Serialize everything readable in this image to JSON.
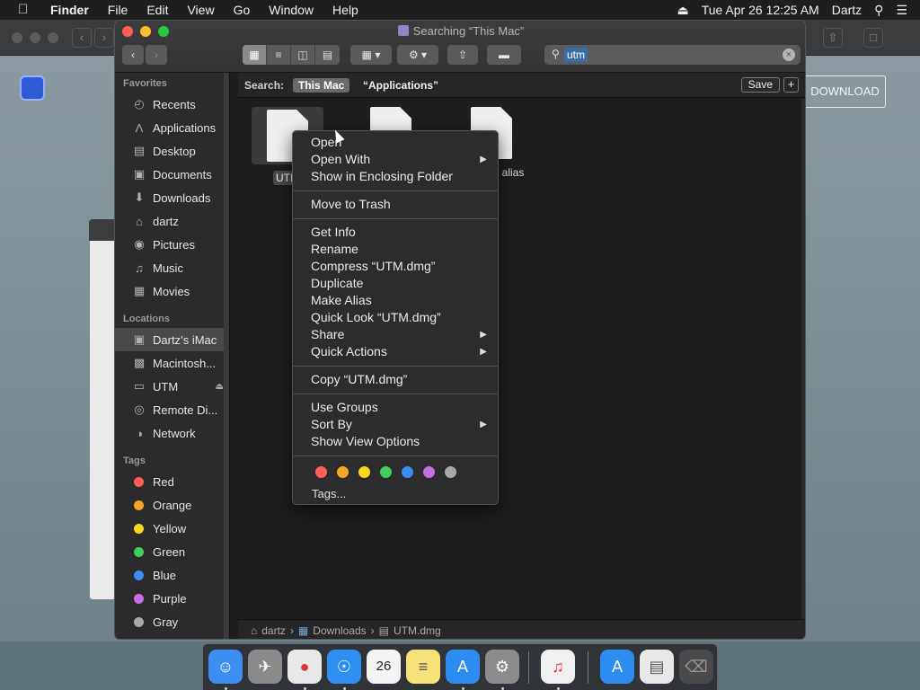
{
  "menubar": {
    "app_name": "Finder",
    "items": [
      "File",
      "Edit",
      "View",
      "Go",
      "Window",
      "Help"
    ],
    "datetime": "Tue Apr 26  12:25 AM",
    "user": "Dartz"
  },
  "background": {
    "download_label": "DOWNLOAD"
  },
  "window": {
    "title": "Searching “This Mac”",
    "search_value": "utm"
  },
  "sidebar": {
    "favorites_header": "Favorites",
    "favorites": [
      {
        "label": "Recents",
        "icon": "recents-icon"
      },
      {
        "label": "Applications",
        "icon": "applications-icon"
      },
      {
        "label": "Desktop",
        "icon": "desktop-icon"
      },
      {
        "label": "Documents",
        "icon": "documents-icon"
      },
      {
        "label": "Downloads",
        "icon": "downloads-icon"
      },
      {
        "label": "dartz",
        "icon": "home-icon"
      },
      {
        "label": "Pictures",
        "icon": "pictures-icon"
      },
      {
        "label": "Music",
        "icon": "music-icon"
      },
      {
        "label": "Movies",
        "icon": "movies-icon"
      }
    ],
    "locations_header": "Locations",
    "locations": [
      {
        "label": "Dartz’s iMac",
        "icon": "imac-icon"
      },
      {
        "label": "Macintosh...",
        "icon": "disk-icon"
      },
      {
        "label": "UTM",
        "icon": "volume-icon"
      },
      {
        "label": "Remote Di...",
        "icon": "remote-disc-icon"
      },
      {
        "label": "Network",
        "icon": "network-icon"
      }
    ],
    "tags_header": "Tags",
    "tags": [
      {
        "label": "Red",
        "color": "#ff5f57"
      },
      {
        "label": "Orange",
        "color": "#f5a623"
      },
      {
        "label": "Yellow",
        "color": "#f8d91c"
      },
      {
        "label": "Green",
        "color": "#3ed15a"
      },
      {
        "label": "Blue",
        "color": "#3b8cf5"
      },
      {
        "label": "Purple",
        "color": "#c86de6"
      },
      {
        "label": "Gray",
        "color": "#a8a8a8"
      }
    ]
  },
  "scope": {
    "label": "Search:",
    "active": "This Mac",
    "other": "“Applications”",
    "save_label": "Save",
    "add_label": "+"
  },
  "files": [
    {
      "name": "UTM",
      "selected": true
    },
    {
      "name": "",
      "selected": false
    },
    {
      "name": "g alias",
      "selected": false
    }
  ],
  "context_menu": {
    "groups": [
      [
        {
          "label": "Open"
        },
        {
          "label": "Open With",
          "submenu": true
        },
        {
          "label": "Show in Enclosing Folder"
        }
      ],
      [
        {
          "label": "Move to Trash"
        }
      ],
      [
        {
          "label": "Get Info"
        },
        {
          "label": "Rename"
        },
        {
          "label": "Compress “UTM.dmg”"
        },
        {
          "label": "Duplicate"
        },
        {
          "label": "Make Alias"
        },
        {
          "label": "Quick Look “UTM.dmg”"
        },
        {
          "label": "Share",
          "submenu": true
        },
        {
          "label": "Quick Actions",
          "submenu": true
        }
      ],
      [
        {
          "label": "Copy “UTM.dmg”"
        }
      ],
      [
        {
          "label": "Use Groups"
        },
        {
          "label": "Sort By",
          "submenu": true
        },
        {
          "label": "Show View Options"
        }
      ]
    ],
    "tag_colors": [
      "#ff5f57",
      "#f5a623",
      "#f8d91c",
      "#3ed15a",
      "#3b8cf5",
      "#c86de6",
      "#a8a8a8"
    ],
    "tags_label": "Tags..."
  },
  "path_bar": [
    {
      "label": "dartz",
      "icon": "home-icon"
    },
    {
      "label": "Downloads",
      "icon": "folder-icon"
    },
    {
      "label": "UTM.dmg",
      "icon": "file-icon"
    }
  ],
  "dock": {
    "items": [
      {
        "name": "finder-icon",
        "bg": "#3d8ef0",
        "glyph": "☺",
        "running": true
      },
      {
        "name": "launchpad-icon",
        "bg": "#8a8a8a",
        "glyph": "✈",
        "running": false
      },
      {
        "name": "chrome-icon",
        "bg": "#e8e8e8",
        "glyph": "●",
        "running": true
      },
      {
        "name": "safari-icon",
        "bg": "#2f8ff0",
        "glyph": "☉",
        "running": true
      },
      {
        "name": "calendar-icon",
        "bg": "#f4f4f4",
        "glyph": "26",
        "running": false
      },
      {
        "name": "notes-icon",
        "bg": "#f7e27a",
        "glyph": "≡",
        "running": false
      },
      {
        "name": "app-store-icon",
        "bg": "#2d8cf0",
        "glyph": "A",
        "running": true
      },
      {
        "name": "system-preferences-icon",
        "bg": "#8b8b8b",
        "glyph": "⚙",
        "running": true
      },
      {
        "name": "itunes-icon",
        "bg": "#f0f0f0",
        "glyph": "♫",
        "running": true
      },
      {
        "name": "app-store-download-icon",
        "bg": "#2d8cf0",
        "glyph": "A",
        "running": false
      },
      {
        "name": "dmg-file-icon",
        "bg": "#e8e8e8",
        "glyph": "▤",
        "running": false
      },
      {
        "name": "trash-icon",
        "bg": "#4a4a4a",
        "glyph": "⌧",
        "running": false
      }
    ]
  }
}
